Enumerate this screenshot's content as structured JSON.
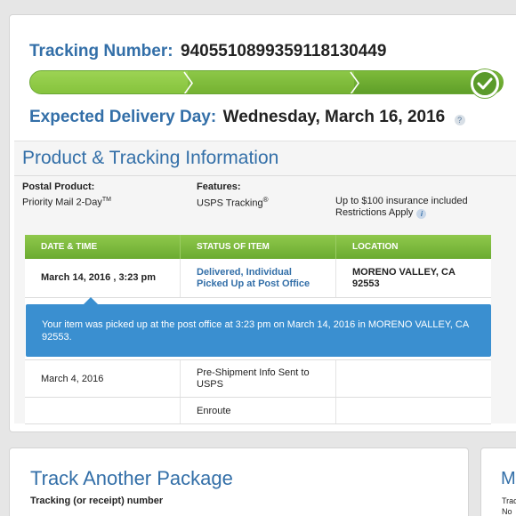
{
  "tracking": {
    "label": "Tracking Number:",
    "number": "9405510899359118130449",
    "progress_fraction": 1.0
  },
  "delivery": {
    "label": "Expected Delivery Day:",
    "date": "Wednesday, March 16, 2016",
    "help_icon": "?"
  },
  "info": {
    "title": "Product & Tracking Information",
    "postal_product_label": "Postal Product:",
    "postal_product_value": "Priority Mail 2-Day",
    "postal_product_sup": "TM",
    "features_label": "Features:",
    "features_value": "USPS Tracking",
    "features_sup": "®",
    "insurance": "Up to $100 insurance included",
    "restrictions": "Restrictions Apply",
    "info_icon": "i"
  },
  "table": {
    "headers": [
      "DATE & TIME",
      "STATUS OF ITEM",
      "LOCATION"
    ],
    "rows": [
      {
        "date": "March 14, 2016 , 3:23 pm",
        "status": "Delivered, Individual Picked Up at Post Office",
        "location": "MORENO VALLEY, CA 92553"
      },
      {
        "date": "March 4, 2016",
        "status": "Pre-Shipment Info Sent to USPS",
        "location": ""
      },
      {
        "date": "",
        "status": "Enroute",
        "location": ""
      }
    ],
    "detail": "Your item was picked up at the post office at 3:23 pm on March 14, 2016 in MORENO VALLEY, CA 92553."
  },
  "track_another": {
    "title": "Track Another Package",
    "label": "Tracking (or receipt) number"
  },
  "right_peek": {
    "title": "Ma",
    "line1": "Trac",
    "line2": "No t"
  },
  "colors": {
    "accent_blue": "#336fa8",
    "progress_green": "#8ec448",
    "bubble_blue": "#3a8fd0"
  }
}
